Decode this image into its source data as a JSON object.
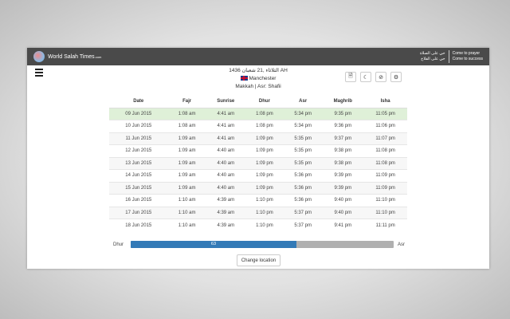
{
  "header": {
    "brand": "World Salah Times",
    "brand_suffix": ".com",
    "arabic_line1": "حي على الصلاة",
    "arabic_line2": "حي على الفلاح",
    "english_line1": "Come to prayer",
    "english_line2": "Come to success"
  },
  "info": {
    "hijri_date": "الثلاثاء ,21 شعبان 1436 AH",
    "city": "Manchester",
    "method": "Makkah | Asr: Shafii"
  },
  "toolbar": {
    "icons": [
      "pdf-icon",
      "moon-icon",
      "ban-icon",
      "gear-icon"
    ]
  },
  "table": {
    "headers": [
      "Date",
      "Fajr",
      "Sunrise",
      "Dhur",
      "Asr",
      "Maghrib",
      "Isha"
    ],
    "rows": [
      [
        "09 Jun 2015",
        "1:08 am",
        "4:41 am",
        "1:08 pm",
        "5:34 pm",
        "9:35 pm",
        "11:05 pm"
      ],
      [
        "10 Jun 2015",
        "1:08 am",
        "4:41 am",
        "1:08 pm",
        "5:34 pm",
        "9:36 pm",
        "11:06 pm"
      ],
      [
        "11 Jun 2015",
        "1:09 am",
        "4:41 am",
        "1:09 pm",
        "5:35 pm",
        "9:37 pm",
        "11:07 pm"
      ],
      [
        "12 Jun 2015",
        "1:09 am",
        "4:40 am",
        "1:09 pm",
        "5:35 pm",
        "9:38 pm",
        "11:08 pm"
      ],
      [
        "13 Jun 2015",
        "1:09 am",
        "4:40 am",
        "1:09 pm",
        "5:35 pm",
        "9:38 pm",
        "11:08 pm"
      ],
      [
        "14 Jun 2015",
        "1:09 am",
        "4:40 am",
        "1:09 pm",
        "5:36 pm",
        "9:39 pm",
        "11:09 pm"
      ],
      [
        "15 Jun 2015",
        "1:09 am",
        "4:40 am",
        "1:09 pm",
        "5:36 pm",
        "9:39 pm",
        "11:09 pm"
      ],
      [
        "16 Jun 2015",
        "1:10 am",
        "4:39 am",
        "1:10 pm",
        "5:36 pm",
        "9:40 pm",
        "11:10 pm"
      ],
      [
        "17 Jun 2015",
        "1:10 am",
        "4:39 am",
        "1:10 pm",
        "5:37 pm",
        "9:40 pm",
        "11:10 pm"
      ],
      [
        "18 Jun 2015",
        "1:10 am",
        "4:39 am",
        "1:10 pm",
        "5:37 pm",
        "9:41 pm",
        "11:11 pm"
      ]
    ]
  },
  "progress": {
    "from": "Dhur",
    "to": "Asr",
    "percent": 63,
    "label": "63"
  },
  "change_location": "Change location"
}
